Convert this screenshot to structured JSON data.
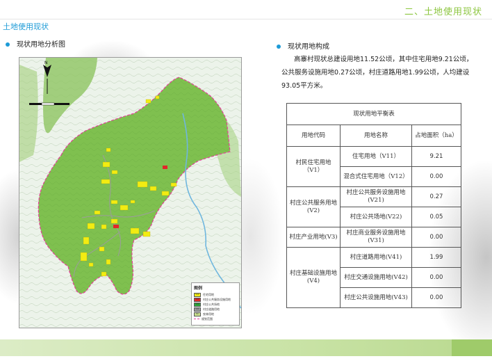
{
  "header": {
    "title": "二、土地使用现状"
  },
  "section": {
    "title": "土地使用现状"
  },
  "left": {
    "subtitle": "现状用地分析图"
  },
  "right": {
    "subtitle": "现状用地构成",
    "description": "高寨村现状总建设用地11.52公顷，其中住宅用地9.21公顷，公共服务设施用地0.27公顷，村庄道路用地1.99公顷，人均建设93.05平方米。"
  },
  "table": {
    "title": "现状用地平衡表",
    "headers": {
      "code": "用地代码",
      "name": "用地名称",
      "area": "占地面积（ha）"
    },
    "groups": [
      {
        "code": "村民住宅用地（V1）",
        "rows": [
          {
            "name": "住宅用地（V11）",
            "area": "9.21"
          },
          {
            "name": "混合式住宅用地（V12）",
            "area": "0.00"
          }
        ]
      },
      {
        "code": "村庄公共服务用地(V2)",
        "rows": [
          {
            "name": "村庄公共服务设施用地(V21)",
            "area": "0.27"
          },
          {
            "name": "村庄公共场地(V22)",
            "area": "0.05"
          }
        ]
      },
      {
        "code": "村庄产业用地(V3)",
        "rows": [
          {
            "name": "村庄商业服务设施用地(V31)",
            "area": "0.00"
          }
        ]
      },
      {
        "code": "村庄基础设施用地(V4)",
        "rows": [
          {
            "name": "村庄道路用地(V41)",
            "area": "1.99"
          },
          {
            "name": "村庄交通设施用地(V42)",
            "area": "0.00"
          },
          {
            "name": "村庄公共设施用地(V43)",
            "area": "0.00"
          }
        ]
      }
    ]
  },
  "legend": {
    "title": "图例",
    "items": [
      {
        "code": "V11",
        "label": "住宅用地",
        "color": "#f2ec12"
      },
      {
        "code": "V21",
        "label": "村庄公共服务设施用地",
        "color": "#e3262a"
      },
      {
        "code": "V22",
        "label": "村庄公共场地",
        "color": "#2ea83a"
      },
      {
        "code": "V41",
        "label": "村庄道路用地",
        "color": "#9c9c9c"
      },
      {
        "code": "E2",
        "label": "农林用地",
        "color": "#c9e08c"
      },
      {
        "code": "",
        "label": "规划范围",
        "color": "#e6409b"
      }
    ]
  },
  "colors": {
    "accent_blue": "#1d9bd7",
    "accent_green": "#8cc63f",
    "farmland": "#7fc04f",
    "boundary": "#e6409b"
  }
}
